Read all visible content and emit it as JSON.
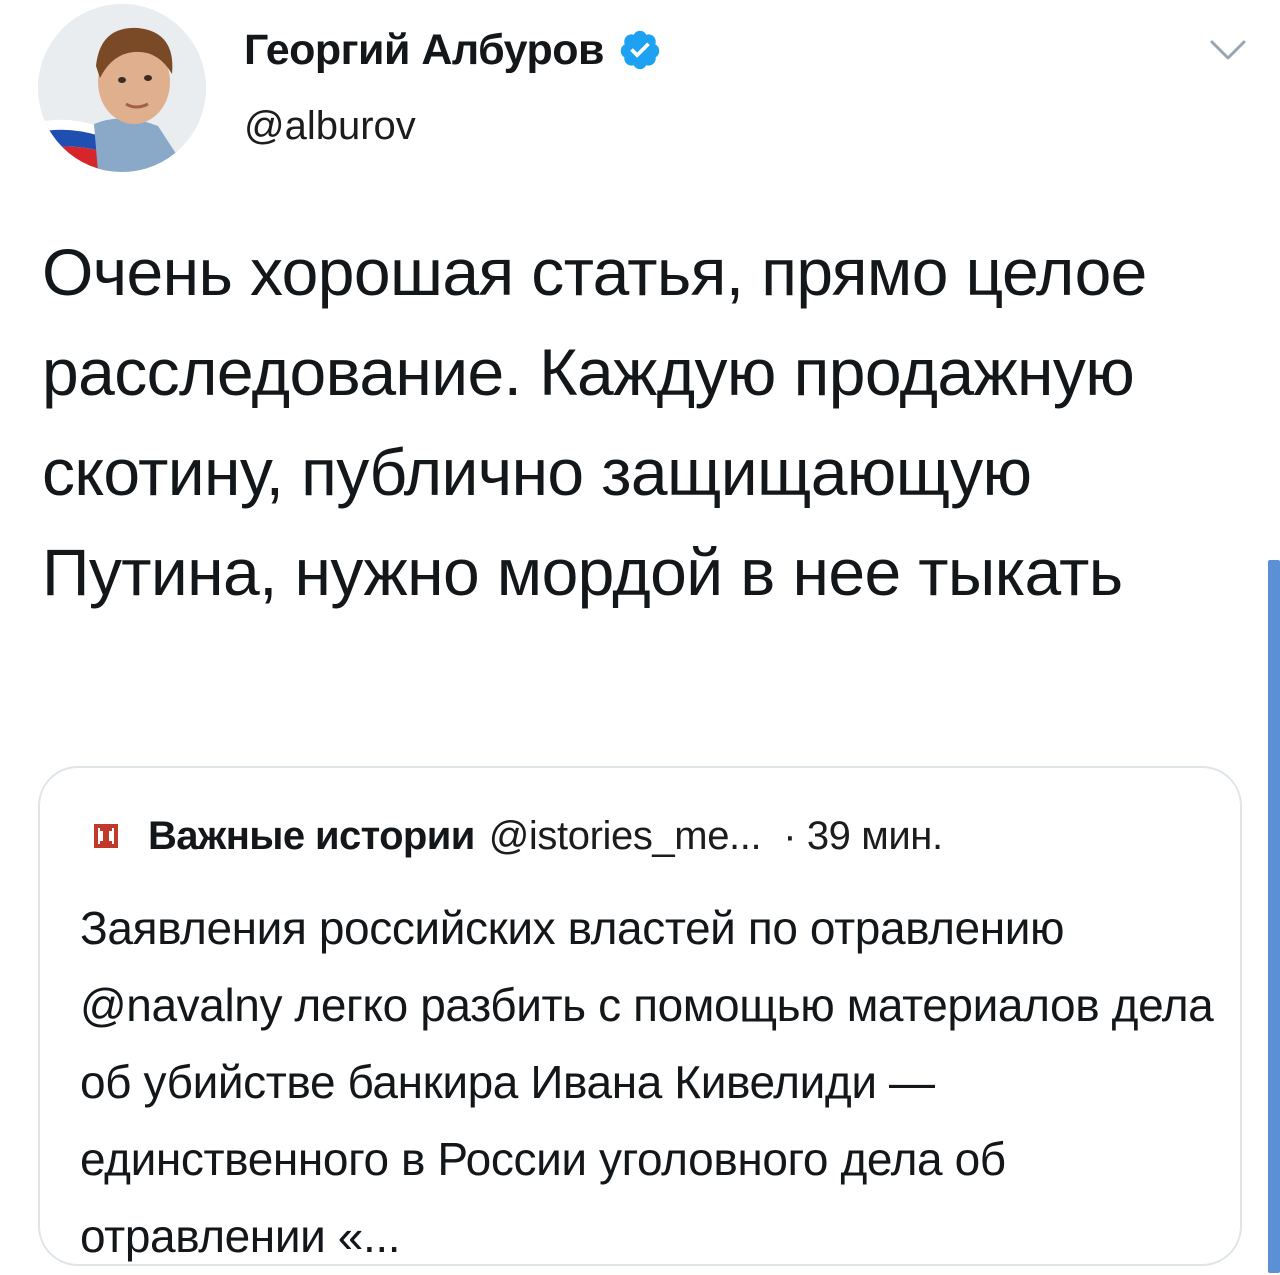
{
  "author": {
    "display_name": "Георгий Албуров",
    "handle": "@alburov",
    "verified": true,
    "verified_color": "#1da1f2"
  },
  "tweet": {
    "text": "Очень хорошая статья, прямо целое расследование. Каждую продажную скотину, публично защищающую Путина, нужно мордой в нее тыкать"
  },
  "quoted_tweet": {
    "source_name": "Важные истории",
    "source_handle": "@istories_me...",
    "time": "· 39 мин.",
    "source_logo_color": "#c0392b",
    "text": "Заявления российских властей  по отравлению @navalny легко разбить с помощью материалов дела об убийстве банкира Ивана Кивелиди — единственного в России уголовного дела об отравлении «..."
  },
  "icons": {
    "avatar": "profile-photo",
    "verified": "verified-badge-icon",
    "menu": "chevron-down-icon",
    "source_logo": "istories-logo-icon"
  },
  "colors": {
    "border": "#dfe4e8",
    "text": "#14171a",
    "scrollbar": "#5b8fd6"
  }
}
